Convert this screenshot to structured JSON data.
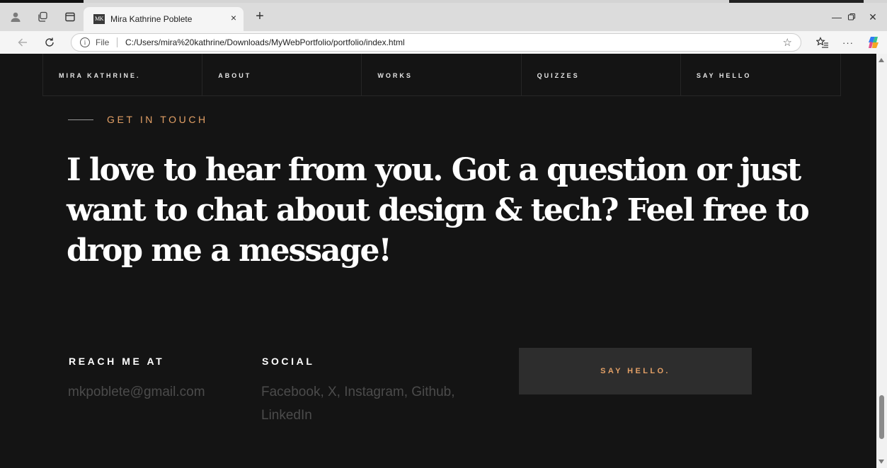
{
  "browser": {
    "tab": {
      "favicon_text": "MK",
      "title": "Mira Kathrine Poblete",
      "close_glyph": "×"
    },
    "new_tab_glyph": "+",
    "address": {
      "scheme_label": "File",
      "url": "C:/Users/mira%20kathrine/Downloads/MyWebPortfolio/portfolio/index.html"
    },
    "window_controls": {
      "minimize": "—",
      "close": "✕"
    },
    "more_glyph": "···",
    "icons": [
      "profile-icon",
      "workspaces-icon",
      "tab-actions-icon",
      "back-icon",
      "refresh-icon",
      "info-icon",
      "favorite-star-icon",
      "favorites-icon",
      "more-icon",
      "copilot-icon"
    ]
  },
  "site": {
    "nav": {
      "brand": "MIRA KATHRINE.",
      "items": [
        "ABOUT",
        "WORKS",
        "QUIZZES",
        "SAY HELLO"
      ]
    },
    "contact": {
      "eyebrow": "GET IN TOUCH",
      "headline": "I love to hear from you. Got a question or just want to chat about design & tech? Feel free to drop me a message!",
      "reach": {
        "label": "REACH ME AT",
        "value": "mkpoblete@gmail.com"
      },
      "social": {
        "label": "SOCIAL",
        "value": "Facebook, X, Instagram, Github, LinkedIn"
      },
      "cta_label": "SAY HELLO."
    }
  },
  "colors": {
    "page_background": "#141414",
    "accent": "#e3a066",
    "muted_text": "#4b4b4b",
    "cta_background": "#2d2d2d"
  }
}
